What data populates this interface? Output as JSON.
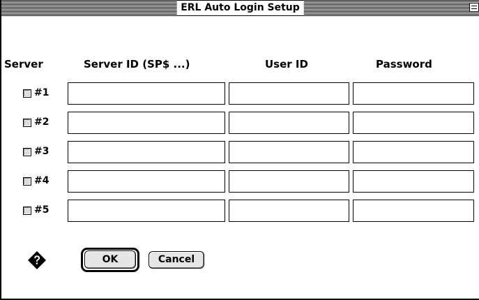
{
  "window": {
    "title": "ERL Auto Login Setup"
  },
  "headers": {
    "server": "Server",
    "server_id": "Server ID (SP$ ...)",
    "user_id": "User ID",
    "password": "Password"
  },
  "rows": [
    {
      "label": "#1",
      "checked": false,
      "server_id": "",
      "user_id": "",
      "password": ""
    },
    {
      "label": "#2",
      "checked": false,
      "server_id": "",
      "user_id": "",
      "password": ""
    },
    {
      "label": "#3",
      "checked": false,
      "server_id": "",
      "user_id": "",
      "password": ""
    },
    {
      "label": "#4",
      "checked": false,
      "server_id": "",
      "user_id": "",
      "password": ""
    },
    {
      "label": "#5",
      "checked": false,
      "server_id": "",
      "user_id": "",
      "password": ""
    }
  ],
  "buttons": {
    "ok_label": "OK",
    "cancel_label": "Cancel"
  },
  "icons": {
    "help": "help-diamond-icon",
    "zoom": "zoom-box-icon"
  }
}
